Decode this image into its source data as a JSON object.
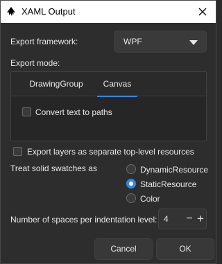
{
  "window": {
    "title": "XAML Output"
  },
  "framework": {
    "label": "Export framework:",
    "selected": "WPF"
  },
  "export_mode": {
    "label": "Export mode:",
    "tabs": [
      "DrawingGroup",
      "Canvas"
    ],
    "active_tab": "Canvas",
    "convert_text_label": "Convert text to paths"
  },
  "export_layers_label": "Export layers as separate top-level resources",
  "swatches": {
    "label": "Treat solid swatches as",
    "options": [
      "DynamicResource",
      "StaticResource",
      "Color"
    ],
    "selected": "StaticResource"
  },
  "indent": {
    "label": "Number of spaces per indentation level:",
    "value": "4"
  },
  "buttons": {
    "cancel": "Cancel",
    "ok": "OK"
  },
  "colors": {
    "accent": "#2f8ae6",
    "background": "#2d2d2d"
  }
}
